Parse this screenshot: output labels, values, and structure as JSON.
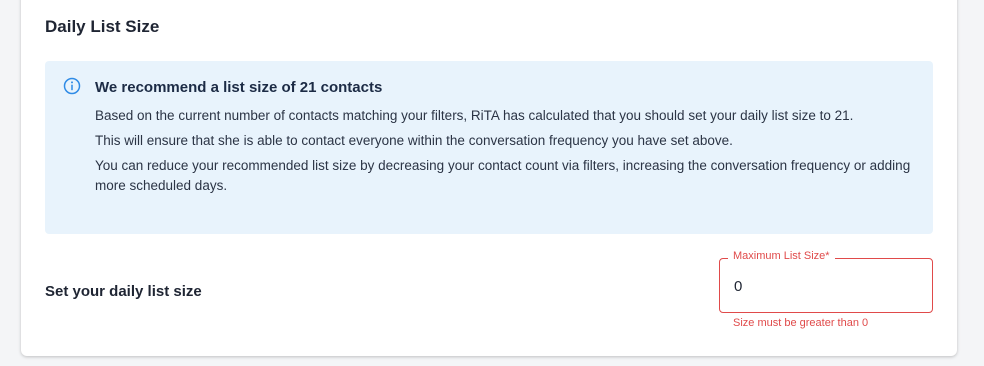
{
  "section": {
    "title": "Daily List Size"
  },
  "recommendation": {
    "icon": "info-icon",
    "title": "We recommend a list size of 21 contacts",
    "paragraphs": [
      "Based on the current number of contacts matching your filters, RiTA has calculated that you should set your daily list size to 21.",
      "This will ensure that she is able to contact everyone within the conversation frequency you have set above.",
      "You can reduce your recommended list size by decreasing your contact count via filters, increasing the conversation frequency or adding more scheduled days."
    ]
  },
  "list_size": {
    "label": "Set your daily list size",
    "field_label": "Maximum List Size*",
    "value": "0",
    "error": "Size must be greater than 0"
  },
  "colors": {
    "accent": "#2f8be6",
    "error": "#e04a4a",
    "info_background": "#e8f3fc"
  }
}
